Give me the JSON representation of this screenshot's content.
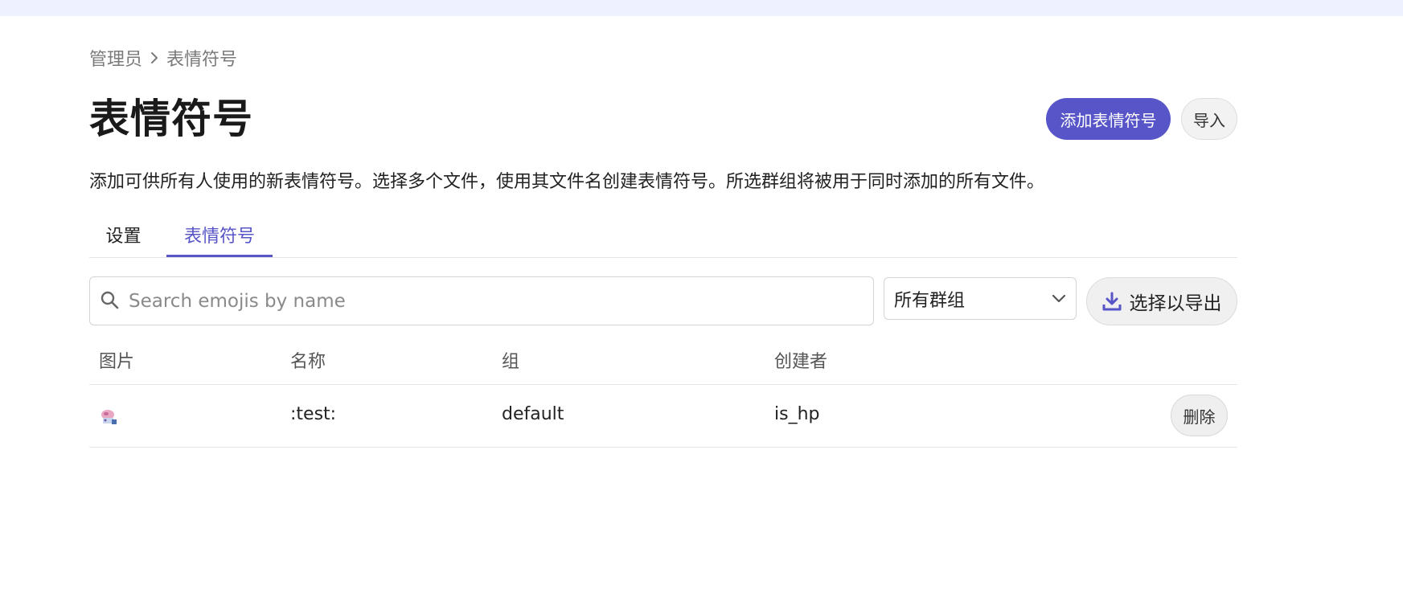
{
  "breadcrumb": {
    "items": [
      "管理员",
      "表情符号"
    ]
  },
  "header": {
    "title": "表情符号",
    "add_button": "添加表情符号",
    "import_button": "导入"
  },
  "description": "添加可供所有人使用的新表情符号。选择多个文件，使用其文件名创建表情符号。所选群组将被用于同时添加的所有文件。",
  "tabs": [
    {
      "label": "设置",
      "active": false
    },
    {
      "label": "表情符号",
      "active": true
    }
  ],
  "toolbar": {
    "search_placeholder": "Search emojis by name",
    "group_select_value": "所有群组",
    "export_button": "选择以导出"
  },
  "table": {
    "columns": [
      "图片",
      "名称",
      "组",
      "创建者"
    ],
    "rows": [
      {
        "name": ":test:",
        "group": "default",
        "creator": "is_hp",
        "delete_label": "删除"
      }
    ]
  },
  "colors": {
    "accent": "#5755c7",
    "topbar": "#eef1ff"
  },
  "icons": {
    "breadcrumb_separator": "chevron-right-icon",
    "search": "search-icon",
    "select": "chevron-down-icon",
    "export": "download-icon"
  }
}
